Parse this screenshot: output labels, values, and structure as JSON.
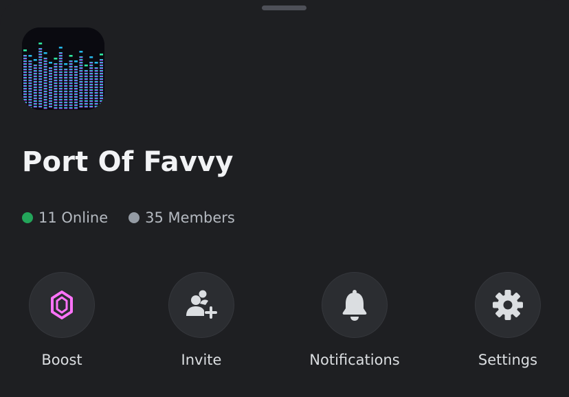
{
  "server": {
    "name": "Port Of Favvy",
    "online_count": "11 Online",
    "member_count": "35 Members",
    "online_color": "#23a55a",
    "offline_color": "#949ba4",
    "icon": "equalizer-artwork"
  },
  "actions": [
    {
      "label": "Boost",
      "icon": "boost-gem-icon",
      "icon_color": "#ff73fa"
    },
    {
      "label": "Invite",
      "icon": "add-user-icon"
    },
    {
      "label": "Notifications",
      "icon": "bell-icon"
    },
    {
      "label": "Settings",
      "icon": "gear-icon"
    }
  ]
}
